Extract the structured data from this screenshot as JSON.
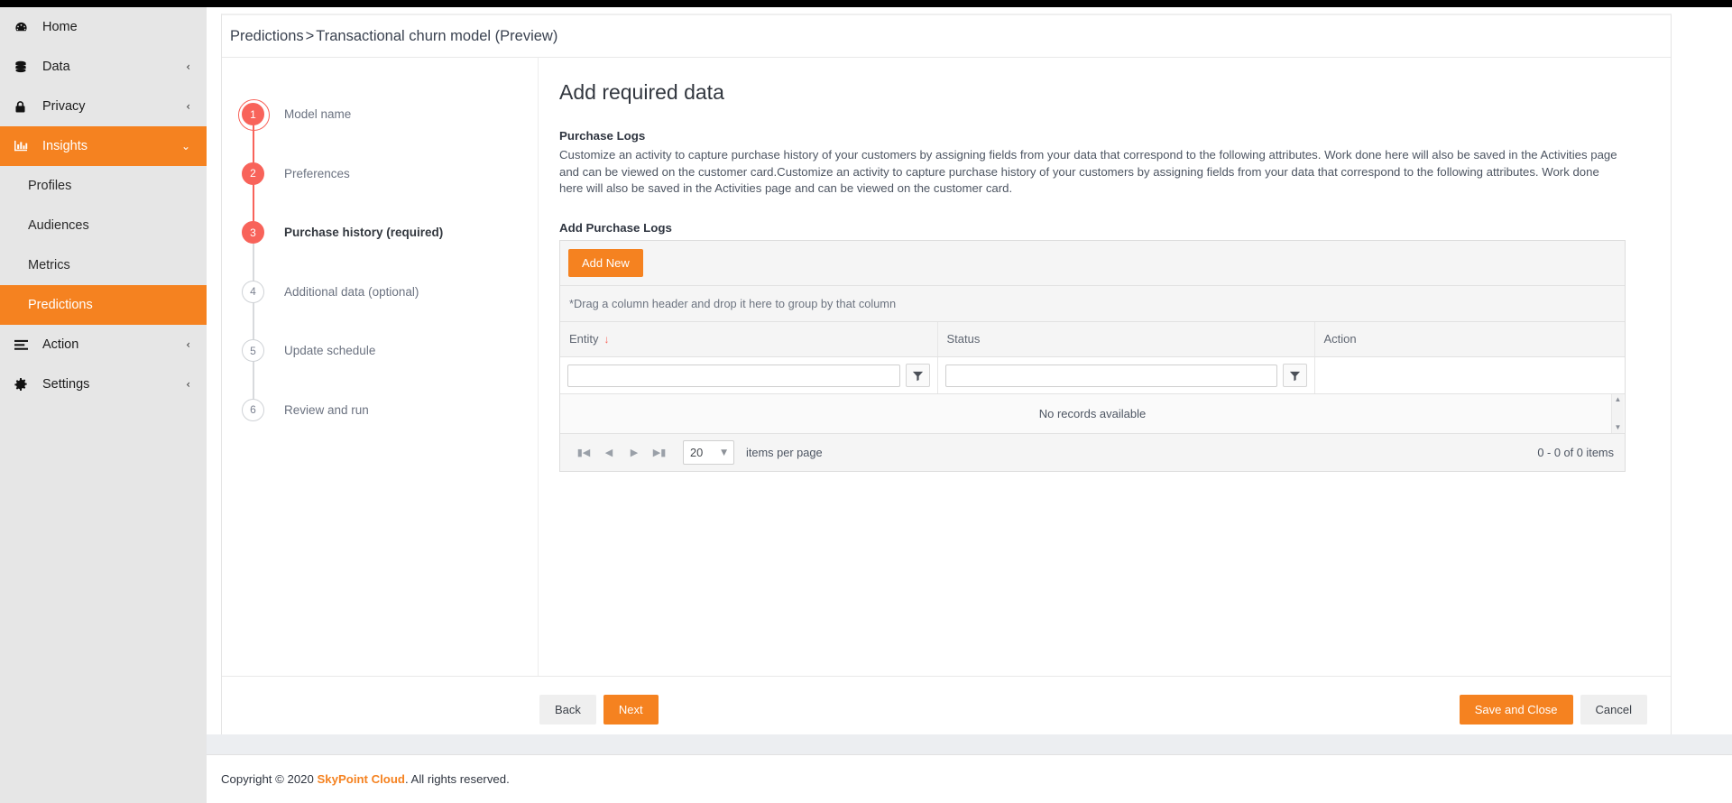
{
  "sidebar": {
    "items": [
      {
        "label": "Home",
        "icon": "dashboard-icon",
        "chevron": "",
        "state": "normal"
      },
      {
        "label": "Data",
        "icon": "database-icon",
        "chevron": "‹",
        "state": "normal"
      },
      {
        "label": "Privacy",
        "icon": "lock-icon",
        "chevron": "‹",
        "state": "normal"
      },
      {
        "label": "Insights",
        "icon": "chart-bar-icon",
        "chevron": "⌄",
        "state": "expanded"
      }
    ],
    "sub_items": [
      {
        "label": "Profiles",
        "selected": false
      },
      {
        "label": "Audiences",
        "selected": false
      },
      {
        "label": "Metrics",
        "selected": false
      },
      {
        "label": "Predictions",
        "selected": true
      }
    ],
    "items_after": [
      {
        "label": "Action",
        "icon": "list-icon",
        "chevron": "‹",
        "state": "normal"
      },
      {
        "label": "Settings",
        "icon": "gear-icon",
        "chevron": "‹",
        "state": "normal"
      }
    ]
  },
  "breadcrumb": {
    "root": "Predictions",
    "separator": ">",
    "current": "Transactional churn model (Preview)"
  },
  "stepper": {
    "steps": [
      {
        "num": "1",
        "label": "Model name",
        "state": "done"
      },
      {
        "num": "2",
        "label": "Preferences",
        "state": "done"
      },
      {
        "num": "3",
        "label": "Purchase history (required)",
        "state": "current"
      },
      {
        "num": "4",
        "label": "Additional data (optional)",
        "state": "todo"
      },
      {
        "num": "5",
        "label": "Update schedule",
        "state": "todo"
      },
      {
        "num": "6",
        "label": "Review and run",
        "state": "todo"
      }
    ]
  },
  "panel": {
    "title": "Add required data",
    "subtitle": "Purchase Logs",
    "description": "Customize an activity to capture purchase history of your customers by assigning fields from your data that correspond to the following attributes. Work done here will also be saved in the Activities page and can be viewed on the customer card.Customize an activity to capture purchase history of your customers by assigning fields from your data that correspond to the following attributes. Work done here will also be saved in the Activities page and can be viewed on the customer card.",
    "section_label": "Add Purchase Logs"
  },
  "grid": {
    "add_new_label": "Add New",
    "group_hint": "*Drag a column header and drop it here to group by that column",
    "columns": [
      {
        "label": "Entity",
        "sort": "desc"
      },
      {
        "label": "Status",
        "sort": ""
      },
      {
        "label": "Action",
        "sort": ""
      }
    ],
    "filters": [
      {
        "value": "",
        "placeholder": "",
        "has_button": true
      },
      {
        "value": "",
        "placeholder": "",
        "has_button": true
      },
      {
        "value": "",
        "placeholder": "",
        "has_button": false
      }
    ],
    "empty_message": "No records available",
    "pager": {
      "first_icon": "first-page-icon",
      "prev_icon": "prev-page-icon",
      "next_icon": "next-page-icon",
      "last_icon": "last-page-icon",
      "page_size": "20",
      "items_per_page_label": "items per page",
      "count_label": "0 - 0 of 0 items"
    }
  },
  "footer_buttons": {
    "back": "Back",
    "next": "Next",
    "save_and_close": "Save and Close",
    "cancel": "Cancel"
  },
  "page_footer": {
    "prefix": "Copyright © 2020",
    "brand": "SkyPoint Cloud",
    "suffix": ". All rights reserved."
  },
  "colors": {
    "brand_orange": "#f58220",
    "step_red": "#f8635a",
    "sidebar_bg": "#e6e6e6"
  }
}
